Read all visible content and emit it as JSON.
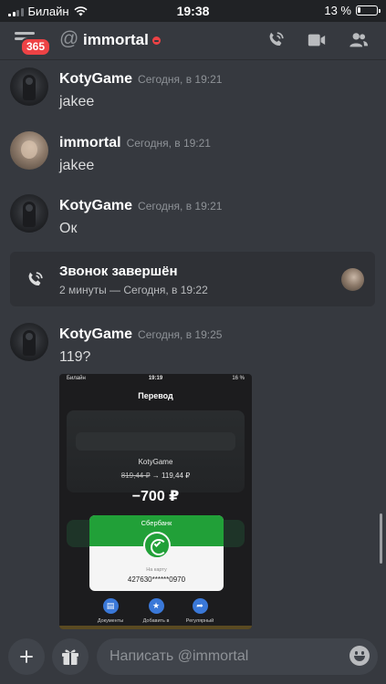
{
  "status_bar": {
    "carrier": "Билайн",
    "time": "19:38",
    "battery": "13 %",
    "battery_level": 0.13
  },
  "header": {
    "unread_badge": "365",
    "channel_prefix": "@",
    "channel_name": "immortal",
    "status": "do-not-disturb",
    "icons": [
      "call-icon",
      "video-icon",
      "members-icon"
    ]
  },
  "messages": [
    {
      "author": "KotyGame",
      "timestamp": "Сегодня, в 19:21",
      "text": "jakee"
    },
    {
      "author": "immortal",
      "timestamp": "Сегодня, в 19:21",
      "text": "jakee"
    },
    {
      "author": "KotyGame",
      "timestamp": "Сегодня, в 19:21",
      "text": "Ок"
    },
    {
      "author": "KotyGame",
      "timestamp": "Сегодня, в 19:25",
      "text": "119?"
    }
  ],
  "call": {
    "title": "Звонок завершён",
    "subtitle": "2 минуты — Сегодня, в 19:22"
  },
  "attachment": {
    "carrier": "Билайн",
    "time": "19:19",
    "battery": "16 %",
    "title": "Перевод",
    "recipient": "KotyGame",
    "balance_before": "819,44 ₽",
    "balance_arrow": "→",
    "balance_after": "119,44 ₽",
    "amount": "−700 ₽",
    "bank": "Сбербанк",
    "card_label": "На карту",
    "card_number": "427630******0970",
    "actions": [
      "Документы",
      "Добавить в",
      "Регулярный"
    ]
  },
  "composer": {
    "placeholder": "Написать @immortal"
  }
}
